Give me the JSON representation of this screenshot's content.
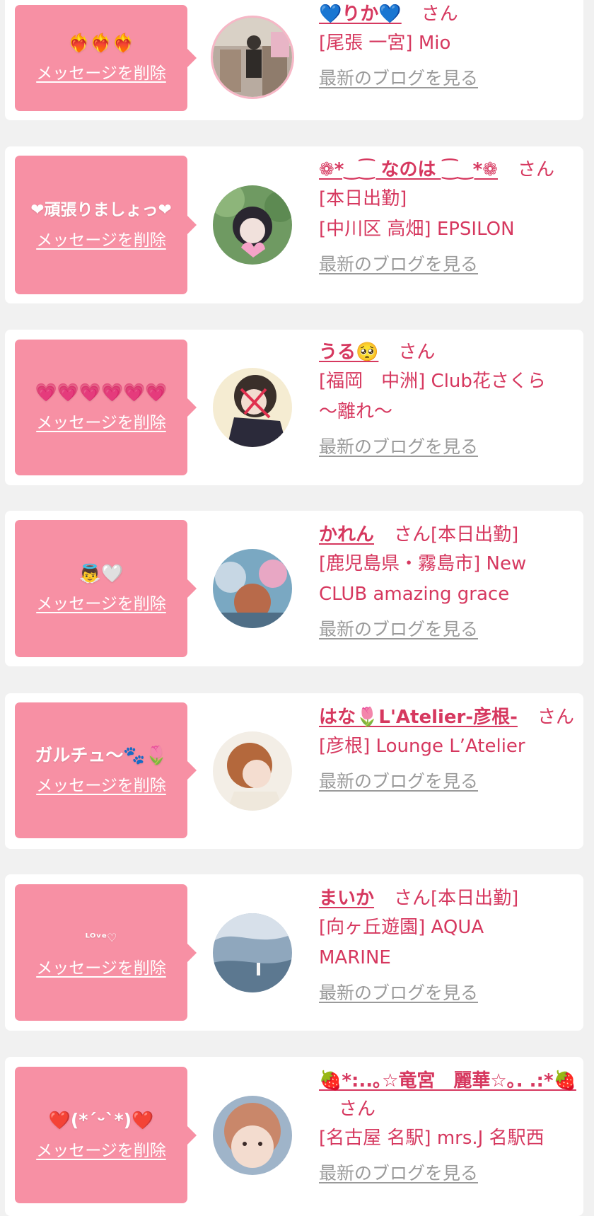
{
  "colors": {
    "background": "#f1f1f1",
    "card": "#ffffff",
    "bubble": "#f790a4",
    "accent": "#d6385f",
    "link_gray": "#9a9a9a"
  },
  "labels": {
    "delete_message": "メッセージを削除",
    "honorific": "さん",
    "latest_blog": "最新のブログを見る"
  },
  "items": [
    {
      "message": "❤️‍🔥❤️‍🔥❤️‍🔥",
      "name": "💙りか💙",
      "status": "",
      "shop_lines": [
        "[尾張 一宮] Mio"
      ],
      "avatar_icon": "photo-avatar"
    },
    {
      "message": "❤頑張りましょっ❤",
      "name": "❁*‿⁐ なのは ⁐‿*❁",
      "status": "",
      "shop_lines": [
        "[本日出勤]",
        "[中川区 高畑] EPSILON"
      ],
      "avatar_icon": "photo-avatar"
    },
    {
      "message": "💗💗💗💗💗💗",
      "name": "うる🥺",
      "status": "",
      "shop_lines": [
        "[福岡　中洲] Club花さくら",
        "～離れ～"
      ],
      "avatar_icon": "photo-avatar"
    },
    {
      "message": "👼🤍",
      "name": "かれん",
      "status": "[本日出勤]",
      "shop_lines": [
        "[鹿児島県・霧島市] New",
        "CLUB amazing grace"
      ],
      "avatar_icon": "photo-avatar"
    },
    {
      "message": "ガルチュ〜🐾🌷",
      "name": "はな🌷L'Atelier-彦根-",
      "status": "",
      "shop_lines": [
        "[彦根] Lounge L’Atelier"
      ],
      "avatar_icon": "photo-avatar"
    },
    {
      "message": "ᴸᴼᵛᵉ♡",
      "name": "まいか",
      "status": "[本日出勤]",
      "shop_lines": [
        "[向ヶ丘遊園] AQUA",
        "MARINE"
      ],
      "avatar_icon": "photo-avatar"
    },
    {
      "message": "❤️(*´ᵕ`*)❤️",
      "name": "🍓*:..｡☆竜宮　麗華☆｡. .:*🍓",
      "status": "",
      "shop_lines": [
        "[名古屋 名駅] mrs.J 名駅西"
      ],
      "avatar_icon": "photo-avatar"
    }
  ]
}
